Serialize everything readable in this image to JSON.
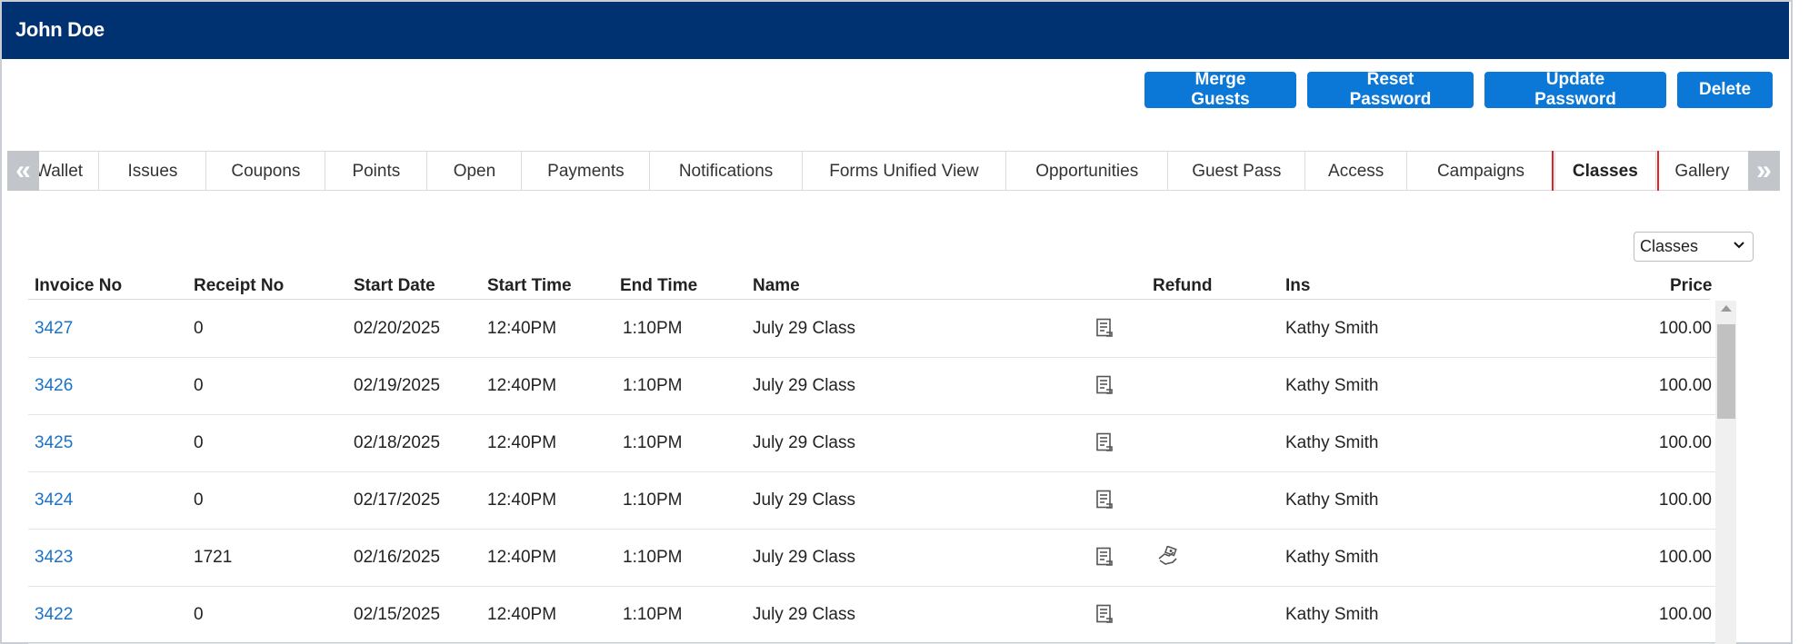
{
  "header": {
    "title": "John Doe"
  },
  "actions": {
    "merge": "Merge Guests",
    "reset": "Reset Password",
    "update": "Update Password",
    "delete": "Delete"
  },
  "tabs": {
    "left_arrow": "«",
    "right_arrow": "»",
    "items": [
      {
        "label": "Wallet"
      },
      {
        "label": "Issues"
      },
      {
        "label": "Coupons"
      },
      {
        "label": "Points"
      },
      {
        "label": "Open"
      },
      {
        "label": "Payments"
      },
      {
        "label": "Notifications"
      },
      {
        "label": "Forms Unified View"
      },
      {
        "label": "Opportunities"
      },
      {
        "label": "Guest Pass"
      },
      {
        "label": "Access"
      },
      {
        "label": "Campaigns"
      },
      {
        "label": "Classes"
      },
      {
        "label": "Gallery"
      }
    ],
    "active": "Classes"
  },
  "filter": {
    "selected": "Classes"
  },
  "table": {
    "headers": {
      "invoice": "Invoice No",
      "receipt": "Receipt No",
      "start_date": "Start Date",
      "start_time": "Start Time",
      "end_time": "End Time",
      "name": "Name",
      "refund": "Refund",
      "ins": "Ins",
      "price": "Price"
    },
    "rows": [
      {
        "invoice": "3427",
        "receipt": "0",
        "start_date": "02/20/2025",
        "start_time": "12:40PM",
        "end_time": "1:10PM",
        "name": "July 29 Class",
        "refund": false,
        "ins": "Kathy Smith",
        "price": "100.00"
      },
      {
        "invoice": "3426",
        "receipt": "0",
        "start_date": "02/19/2025",
        "start_time": "12:40PM",
        "end_time": "1:10PM",
        "name": "July 29 Class",
        "refund": false,
        "ins": "Kathy Smith",
        "price": "100.00"
      },
      {
        "invoice": "3425",
        "receipt": "0",
        "start_date": "02/18/2025",
        "start_time": "12:40PM",
        "end_time": "1:10PM",
        "name": "July 29 Class",
        "refund": false,
        "ins": "Kathy Smith",
        "price": "100.00"
      },
      {
        "invoice": "3424",
        "receipt": "0",
        "start_date": "02/17/2025",
        "start_time": "12:40PM",
        "end_time": "1:10PM",
        "name": "July 29 Class",
        "refund": false,
        "ins": "Kathy Smith",
        "price": "100.00"
      },
      {
        "invoice": "3423",
        "receipt": "1721",
        "start_date": "02/16/2025",
        "start_time": "12:40PM",
        "end_time": "1:10PM",
        "name": "July 29 Class",
        "refund": true,
        "ins": "Kathy Smith",
        "price": "100.00"
      },
      {
        "invoice": "3422",
        "receipt": "0",
        "start_date": "02/15/2025",
        "start_time": "12:40PM",
        "end_time": "1:10PM",
        "name": "July 29 Class",
        "refund": false,
        "ins": "Kathy Smith",
        "price": "100.00"
      }
    ]
  },
  "icons": {
    "receipt": "receipt-icon",
    "refund": "refund-icon",
    "chevron": "chevron-down-icon"
  },
  "colors": {
    "header_bg": "#003171",
    "button_bg": "#0b78d8",
    "link": "#1a73c9",
    "active_tab_outline": "#e02424"
  }
}
